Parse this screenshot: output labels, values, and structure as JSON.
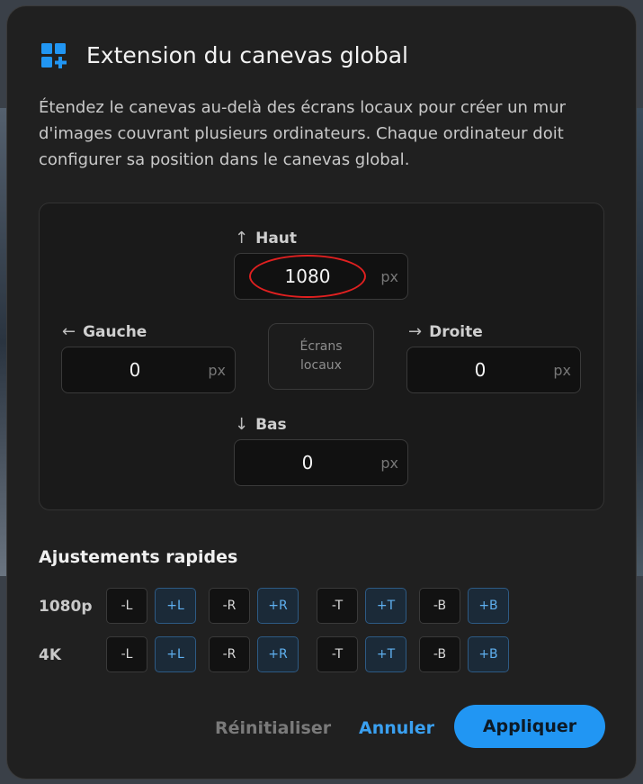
{
  "dialog": {
    "icon": "grid-add-icon",
    "title": "Extension du canevas global",
    "description": "Étendez le canevas au-delà des écrans locaux pour créer un mur d'images couvrant plusieurs ordinateurs. Chaque ordinateur doit configurer sa position dans le canevas global."
  },
  "extents": {
    "top": {
      "label": "Haut",
      "value": "1080",
      "unit": "px",
      "icon": "arrow-up-icon",
      "arrow": "↑"
    },
    "left": {
      "label": "Gauche",
      "value": "0",
      "unit": "px",
      "icon": "arrow-left-icon",
      "arrow": "←"
    },
    "right": {
      "label": "Droite",
      "value": "0",
      "unit": "px",
      "icon": "arrow-right-icon",
      "arrow": "→"
    },
    "bottom": {
      "label": "Bas",
      "value": "0",
      "unit": "px",
      "icon": "arrow-down-icon",
      "arrow": "↓"
    },
    "center_line1": "Écrans",
    "center_line2": "locaux"
  },
  "quick": {
    "title": "Ajustements rapides",
    "rows": [
      {
        "label": "1080p",
        "buttons": [
          "-L",
          "+L",
          "-R",
          "+R",
          "-T",
          "+T",
          "-B",
          "+B"
        ]
      },
      {
        "label": "4K",
        "buttons": [
          "-L",
          "+L",
          "-R",
          "+R",
          "-T",
          "+T",
          "-B",
          "+B"
        ]
      }
    ]
  },
  "actions": {
    "reset": "Réinitialiser",
    "cancel": "Annuler",
    "apply": "Appliquer"
  },
  "colors": {
    "accent": "#2196f3",
    "highlight": "#e02020",
    "dialog_bg": "#202020"
  }
}
